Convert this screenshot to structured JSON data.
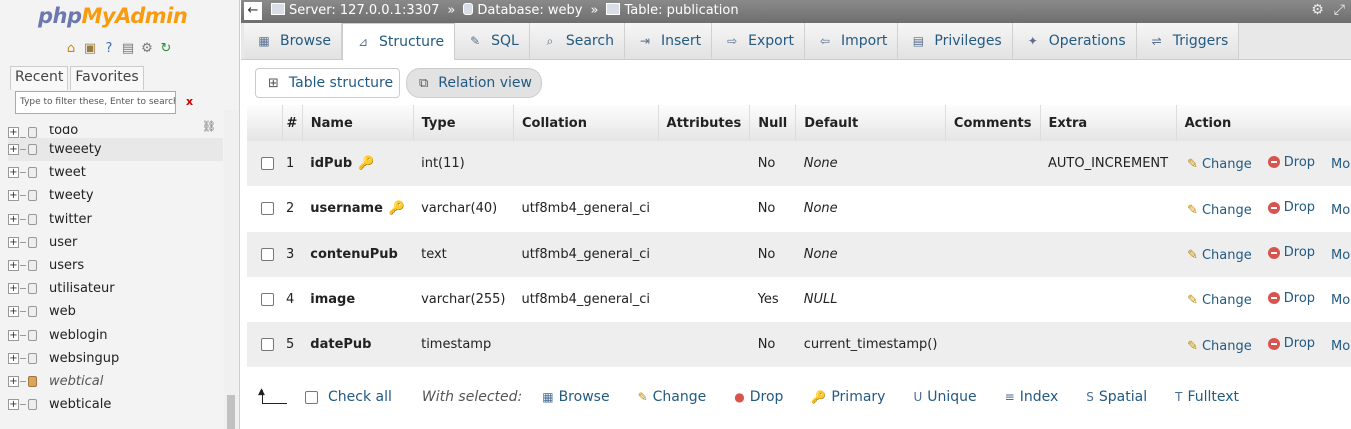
{
  "nav": {
    "logo_left": "php",
    "logo_right": "MyAdmin",
    "tab_recent": "Recent",
    "tab_favorites": "Favorites",
    "filter_placeholder": "Type to filter these, Enter to search al",
    "filter_clear": "x",
    "tree": [
      {
        "label": "todo",
        "partial": true
      },
      {
        "label": "tweeety",
        "highlight": true
      },
      {
        "label": "tweet"
      },
      {
        "label": "tweety"
      },
      {
        "label": "twitter"
      },
      {
        "label": "user"
      },
      {
        "label": "users"
      },
      {
        "label": "utilisateur"
      },
      {
        "label": "web"
      },
      {
        "label": "weblogin"
      },
      {
        "label": "websingup"
      },
      {
        "label": "webtical",
        "view": true
      },
      {
        "label": "webticale"
      }
    ]
  },
  "topbar": {
    "server": "Server: 127.0.0.1:3307",
    "database": "Database: weby",
    "table": "Table: publication",
    "sep": "»"
  },
  "tabs": [
    {
      "label": "Browse",
      "icon": "browse-icon"
    },
    {
      "label": "Structure",
      "icon": "structure-icon",
      "active": true
    },
    {
      "label": "SQL",
      "icon": "sql-icon"
    },
    {
      "label": "Search",
      "icon": "search-icon"
    },
    {
      "label": "Insert",
      "icon": "insert-icon"
    },
    {
      "label": "Export",
      "icon": "export-icon"
    },
    {
      "label": "Import",
      "icon": "import-icon"
    },
    {
      "label": "Privileges",
      "icon": "privileges-icon"
    },
    {
      "label": "Operations",
      "icon": "operations-icon"
    },
    {
      "label": "Triggers",
      "icon": "triggers-icon"
    }
  ],
  "subtabs": {
    "table_structure": "Table structure",
    "relation_view": "Relation view"
  },
  "columns": {
    "num": "#",
    "name": "Name",
    "type": "Type",
    "collation": "Collation",
    "attributes": "Attributes",
    "null": "Null",
    "default": "Default",
    "comments": "Comments",
    "extra": "Extra",
    "action": "Action"
  },
  "rows": [
    {
      "num": "1",
      "name": "idPub",
      "key": "primary",
      "type": "int(11)",
      "collation": "",
      "attributes": "",
      "null": "No",
      "default": "None",
      "default_italic": true,
      "comments": "",
      "extra": "AUTO_INCREMENT"
    },
    {
      "num": "2",
      "name": "username",
      "key": "index",
      "type": "varchar(40)",
      "collation": "utf8mb4_general_ci",
      "attributes": "",
      "null": "No",
      "default": "None",
      "default_italic": true,
      "comments": "",
      "extra": ""
    },
    {
      "num": "3",
      "name": "contenuPub",
      "key": "",
      "type": "text",
      "collation": "utf8mb4_general_ci",
      "attributes": "",
      "null": "No",
      "default": "None",
      "default_italic": true,
      "comments": "",
      "extra": ""
    },
    {
      "num": "4",
      "name": "image",
      "key": "",
      "type": "varchar(255)",
      "collation": "utf8mb4_general_ci",
      "attributes": "",
      "null": "Yes",
      "default": "NULL",
      "default_italic": true,
      "comments": "",
      "extra": ""
    },
    {
      "num": "5",
      "name": "datePub",
      "key": "",
      "type": "timestamp",
      "collation": "",
      "attributes": "",
      "null": "No",
      "default": "current_timestamp()",
      "default_italic": false,
      "comments": "",
      "extra": ""
    }
  ],
  "actions": {
    "change": "Change",
    "drop": "Drop",
    "more": "More"
  },
  "bottom": {
    "check_all": "Check all",
    "with_selected": "With selected:",
    "items": [
      {
        "label": "Browse",
        "icon": "browse-icon"
      },
      {
        "label": "Change",
        "icon": "pencil-icon"
      },
      {
        "label": "Drop",
        "icon": "drop-icon"
      },
      {
        "label": "Primary",
        "icon": "key-icon"
      },
      {
        "label": "Unique",
        "icon": "unique-icon"
      },
      {
        "label": "Index",
        "icon": "index-icon"
      },
      {
        "label": "Spatial",
        "icon": "spatial-icon"
      },
      {
        "label": "Fulltext",
        "icon": "fulltext-icon"
      }
    ]
  },
  "colors": {
    "link": "#235a81",
    "topbar": "#7a7a7a",
    "drop_red": "#d9534f",
    "key_gold": "#d6a400"
  }
}
